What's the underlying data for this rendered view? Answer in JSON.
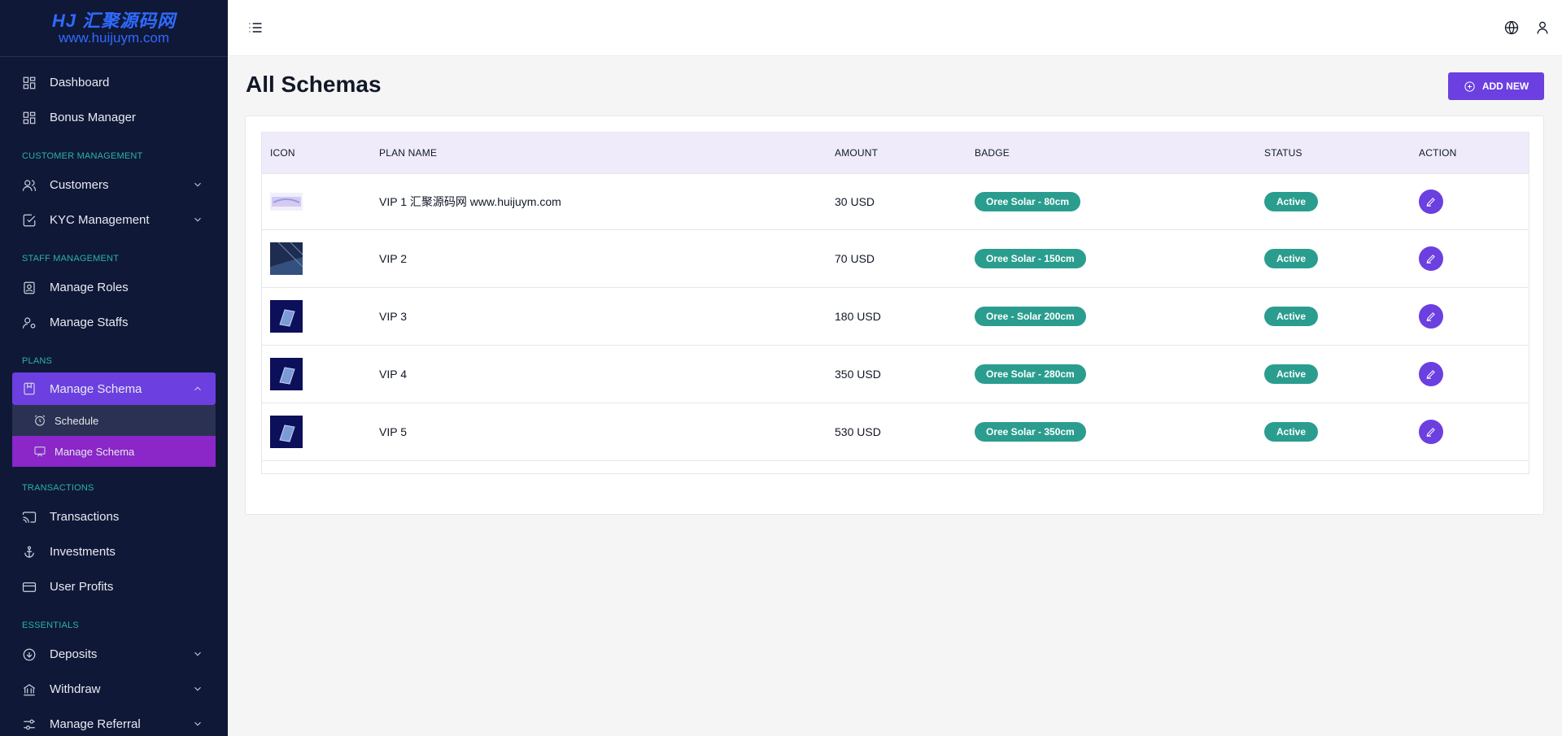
{
  "logo": {
    "brand": "HJ 汇聚源码网",
    "url": "www.huijuym.com"
  },
  "sidebar": {
    "items_top": [
      {
        "label": "Dashboard",
        "icon": "grid-icon"
      },
      {
        "label": "Bonus Manager",
        "icon": "grid-icon"
      }
    ],
    "sections": {
      "customer": "CUSTOMER MANAGEMENT",
      "staff": "STAFF MANAGEMENT",
      "plans": "PLANS",
      "transactions": "TRANSACTIONS",
      "essentials": "ESSENTIALS"
    },
    "customers": "Customers",
    "kyc": "KYC Management",
    "manage_roles": "Manage Roles",
    "manage_staffs": "Manage Staffs",
    "manage_schema": "Manage Schema",
    "sub_schedule": "Schedule",
    "sub_manage_schema": "Manage Schema",
    "transactions": "Transactions",
    "investments": "Investments",
    "user_profits": "User Profits",
    "deposits": "Deposits",
    "withdraw": "Withdraw",
    "manage_referral": "Manage Referral"
  },
  "main": {
    "title": "All Schemas",
    "add_button": "ADD NEW",
    "columns": [
      "ICON",
      "PLAN NAME",
      "AMOUNT",
      "BADGE",
      "STATUS",
      "ACTION"
    ],
    "rows": [
      {
        "plan": "VIP 1 汇聚源码网 www.huijuym.com",
        "amount": "30 USD",
        "badge": "Oree Solar - 80cm",
        "status": "Active"
      },
      {
        "plan": "VIP 2",
        "amount": "70 USD",
        "badge": "Oree Solar - 150cm",
        "status": "Active"
      },
      {
        "plan": "VIP 3",
        "amount": "180 USD",
        "badge": "Oree - Solar 200cm",
        "status": "Active"
      },
      {
        "plan": "VIP 4",
        "amount": "350 USD",
        "badge": "Oree Solar - 280cm",
        "status": "Active"
      },
      {
        "plan": "VIP 5",
        "amount": "530 USD",
        "badge": "Oree Solar - 350cm",
        "status": "Active"
      }
    ]
  },
  "colors": {
    "sidebar_bg": "#0f1837",
    "accent": "#6c3fe0",
    "section": "#2bb3a3",
    "badge": "#2a9d8f",
    "sub_active": "#8b26c9"
  }
}
